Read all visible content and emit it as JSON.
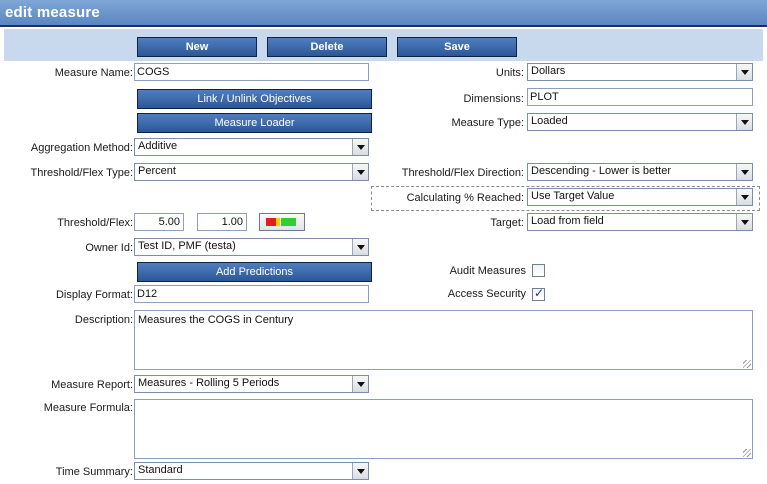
{
  "header": {
    "title": "edit measure"
  },
  "toolbar": {
    "new_label": "New",
    "delete_label": "Delete",
    "save_label": "Save"
  },
  "left": {
    "measure_name_label": "Measure Name:",
    "measure_name_value": "COGS",
    "link_button": "Link / Unlink Objectives",
    "loader_button": "Measure Loader",
    "aggregation_label": "Aggregation Method:",
    "aggregation_value": "Additive",
    "threshold_type_label": "Threshold/Flex Type:",
    "threshold_type_value": "Percent",
    "threshold_flex_label": "Threshold/Flex:",
    "threshold_value": "5.00",
    "flex_value": "1.00",
    "owner_label": "Owner Id:",
    "owner_value": "Test ID, PMF (testa)",
    "predictions_button": "Add Predictions",
    "display_format_label": "Display Format:",
    "display_format_value": "D12"
  },
  "right": {
    "units_label": "Units:",
    "units_value": "Dollars",
    "dimensions_label": "Dimensions:",
    "dimensions_value": "PLOT",
    "measure_type_label": "Measure Type:",
    "measure_type_value": "Loaded",
    "direction_label": "Threshold/Flex Direction:",
    "direction_value": "Descending - Lower is better",
    "calc_label": "Calculating % Reached:",
    "calc_value": "Use Target Value",
    "target_label": "Target:",
    "target_value": "Load from field",
    "audit_label": "Audit Measures",
    "audit_checked": false,
    "access_label": "Access Security",
    "access_checked": true
  },
  "bottom": {
    "description_label": "Description:",
    "description_value": "Measures the COGS in Century",
    "report_label": "Measure Report:",
    "report_value": "Measures - Rolling 5 Periods",
    "formula_label": "Measure Formula:",
    "formula_value": "",
    "time_summary_label": "Time Summary:",
    "time_summary_value": "Standard"
  },
  "icons": {
    "threshold_indicator": "traffic-light-icon",
    "dropdown": "chevron-down-icon",
    "check": "checkmark-icon",
    "resize": "resize-grip-icon"
  },
  "colors": {
    "header": "#5b86c1",
    "header_border": "#1c2f6a",
    "band": "#c8d9ee",
    "button": "#2c5796",
    "red": "#e0201b",
    "yellow": "#f4d000",
    "green": "#2fcf2f"
  }
}
